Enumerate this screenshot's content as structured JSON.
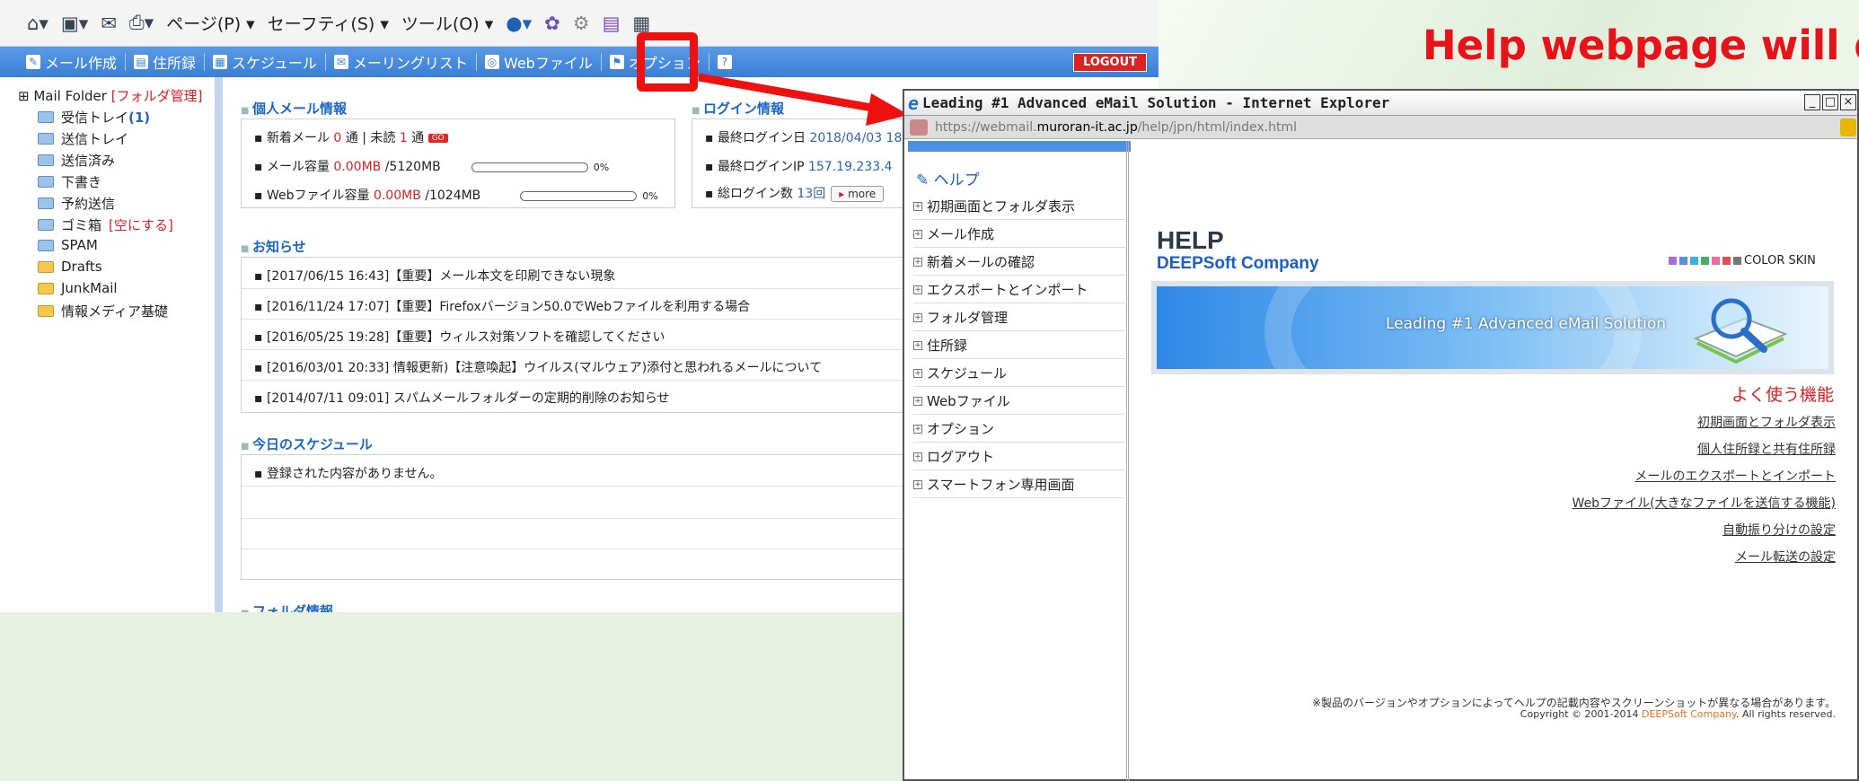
{
  "headline": "Help webpage will d",
  "ie_toolbar": {
    "page_menu": "ページ(P) ▾",
    "safety_menu": "セーフティ(S) ▾",
    "tools_menu": "ツール(O) ▾"
  },
  "app_toolbar": {
    "items": [
      "メール作成",
      "住所録",
      "スケジュール",
      "メーリングリスト",
      "Webファイル",
      "オプション"
    ],
    "help_label": "?",
    "logout": "LOGOUT"
  },
  "sidebar": {
    "root": "Mail Folder",
    "manage": "[フォルダ管理]",
    "folders": [
      {
        "label": "受信トレイ",
        "count": "(1)",
        "color": "blue"
      },
      {
        "label": "送信トレイ",
        "color": "blue"
      },
      {
        "label": "送信済み",
        "color": "blue"
      },
      {
        "label": "下書き",
        "color": "blue"
      },
      {
        "label": "予約送信",
        "color": "blue"
      },
      {
        "label": "ゴミ箱",
        "extra": "[空にする]",
        "color": "blue"
      },
      {
        "label": "SPAM",
        "color": "blue"
      },
      {
        "label": "Drafts",
        "color": "yellow"
      },
      {
        "label": "JunkMail",
        "color": "yellow"
      },
      {
        "label": "情報メディア基礎",
        "color": "yellow"
      }
    ]
  },
  "personal": {
    "title": "個人メール情報",
    "new_mail_label": "新着メール",
    "new_mail_count": "0",
    "unit": "通",
    "unread_label": "| 未読",
    "unread_count": "1",
    "go": "GO",
    "mail_cap_label": "メール容量",
    "mail_used": "0.00MB",
    "mail_total": "/5120MB",
    "mail_pct": "0%",
    "web_cap_label": "Webファイル容量",
    "web_used": "0.00MB",
    "web_total": "/1024MB",
    "web_pct": "0%"
  },
  "login": {
    "title": "ログイン情報",
    "last_date_label": "最終ログイン日",
    "last_date": "2018/04/03 18",
    "last_ip_label": "最終ログインIP",
    "last_ip": "157.19.233.4",
    "total_label": "総ログイン数",
    "total": "13回",
    "more": "more"
  },
  "notices": {
    "title": "お知らせ",
    "items": [
      "[2017/06/15 16:43]【重要】メール本文を印刷できない現象",
      "[2016/11/24 17:07]【重要】Firefoxバージョン50.0でWebファイルを利用する場合",
      "[2016/05/25 19:28]【重要】ウィルス対策ソフトを確認してください",
      "[2016/03/01 20:33] 情報更新)【注意喚起】ウイルス(マルウェア)添付と思われるメールについて",
      "[2014/07/11 09:01] スパムメールフォルダーの定期的削除のお知らせ"
    ]
  },
  "schedule": {
    "title": "今日のスケジュール",
    "empty": "登録された内容がありません。"
  },
  "folder_info": {
    "title": "フォルダ情報"
  },
  "popup": {
    "title": "Leading #1 Advanced eMail Solution - Internet Explorer",
    "url_prefix": "https://webmail.",
    "url_domain": "muroran-it.ac.jp",
    "url_path": "/help/jpn/html/index.html",
    "help_heading": "ヘルプ",
    "nav": [
      "初期画面とフォルダ表示",
      "メール作成",
      "新着メールの確認",
      "エクスポートとインポート",
      "フォルダ管理",
      "住所録",
      "スケジュール",
      "Webファイル",
      "オプション",
      "ログアウト",
      "スマートフォン専用画面"
    ],
    "help_title": "HELP",
    "company": "DEEPSoft Company",
    "color_skin": "COLOR SKIN",
    "banner_text": "Leading #1 Advanced eMail Solution",
    "often_title": "よく使う機能",
    "links": [
      "初期画面とフォルダ表示",
      "個人住所録と共有住所録",
      "メールのエクスポートとインポート",
      "Webファイル(大きなファイルを送信する機能)",
      "自動振り分けの設定",
      "メール転送の設定"
    ],
    "footer_note": "※製品のバージョンやオプションによってヘルプの記載内容やスクリーンショットが異なる場合があります。",
    "copyright_a": "Copyright © 2001-2014 ",
    "copyright_b": "DEEPSoft Company",
    "copyright_c": ". All rights reserved."
  },
  "colors": {
    "headline": "#e8121a",
    "toolbar": "#3a7fd6",
    "highlight": "#f01010",
    "link_blue": "#1966c8"
  }
}
